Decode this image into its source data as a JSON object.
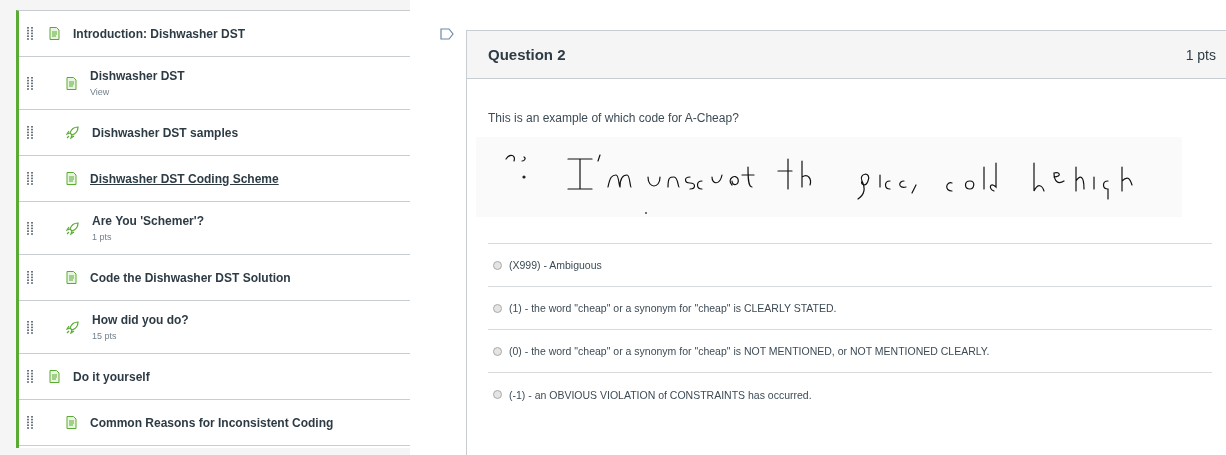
{
  "modules": [
    {
      "kind": "page",
      "title": "Introduction: Dishwasher DST",
      "underlined": false,
      "children": [
        {
          "kind": "page",
          "title": "Dishwasher DST",
          "subtitle": "View",
          "underlined": false
        },
        {
          "kind": "quiz",
          "title": "Dishwasher DST samples",
          "underlined": false
        },
        {
          "kind": "page",
          "title": "Dishwasher DST Coding Scheme",
          "underlined": true
        },
        {
          "kind": "quiz",
          "title": "Are You 'Schemer'?",
          "subtitle": "1 pts",
          "underlined": false
        },
        {
          "kind": "page",
          "title": "Code the Dishwasher DST Solution",
          "underlined": false
        },
        {
          "kind": "quiz",
          "title": "How did you do?",
          "subtitle": "15 pts",
          "underlined": false
        }
      ]
    },
    {
      "kind": "page",
      "title": "Do it yourself",
      "underlined": false,
      "children": [
        {
          "kind": "page",
          "title": "Common Reasons for Inconsistent Coding",
          "underlined": false
        }
      ]
    }
  ],
  "question": {
    "title": "Question 2",
    "points": "1 pts",
    "prompt": "This is an example of which code for A-Cheap?",
    "answers": [
      {
        "label": "(X999) - Ambiguous",
        "selected": false
      },
      {
        "label": "(1) - the word \"cheap\" or a synonym for \"cheap\" is CLEARLY STATED.",
        "selected": false
      },
      {
        "label": "(0) - the word \"cheap\" or a synonym for \"cheap\" is NOT MENTIONED, or NOT MENTIONED CLEARLY.",
        "selected": false
      },
      {
        "label": "(-1) - an OBVIOUS VIOLATION of CONSTRAINTS has occurred.",
        "selected": false
      }
    ]
  }
}
